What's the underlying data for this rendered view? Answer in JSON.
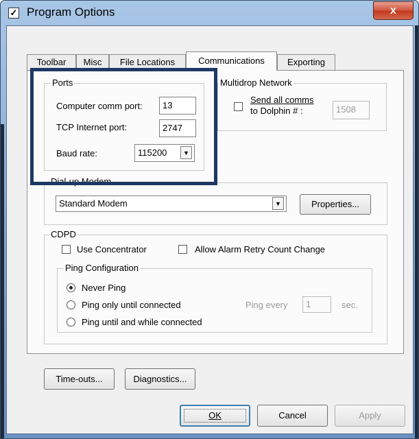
{
  "window": {
    "title": "Program Options",
    "close_glyph": "x"
  },
  "tabs": [
    {
      "label": "Toolbar",
      "active": false
    },
    {
      "label": "Misc",
      "active": false
    },
    {
      "label": "File Locations",
      "active": false
    },
    {
      "label": "Communications",
      "active": true
    },
    {
      "label": "Exporting",
      "active": false
    }
  ],
  "ports": {
    "group_label": "Ports",
    "computer_comm_port_label": "Computer comm port:",
    "computer_comm_port_value": "13",
    "tcp_port_label": "TCP Internet port:",
    "tcp_port_value": "2747",
    "baud_rate_label": "Baud rate:",
    "baud_rate_value": "115200"
  },
  "multidrop": {
    "group_label": "Multidrop Network",
    "send_all_line1": "Send all comms",
    "send_all_line2": "to Dolphin # :",
    "send_all_checked": false,
    "dolphin_number": "1508"
  },
  "dialup": {
    "group_label": "Dial-up Modem",
    "modem_value": "Standard Modem",
    "properties_button": "Properties..."
  },
  "cdpd": {
    "group_label": "CDPD",
    "use_concentrator_label": "Use Concentrator",
    "use_concentrator_checked": false,
    "allow_alarm_label": "Allow Alarm Retry Count Change",
    "allow_alarm_checked": false,
    "ping": {
      "group_label": "Ping Configuration",
      "options": [
        {
          "label": "Never Ping",
          "checked": true
        },
        {
          "label": "Ping only until connected",
          "checked": false
        },
        {
          "label": "Ping until and while connected",
          "checked": false
        }
      ],
      "ping_every_label": "Ping every",
      "ping_every_value": "1",
      "sec_label": "sec."
    }
  },
  "buttons": {
    "timeouts": "Time-outs...",
    "diagnostics": "Diagnostics...",
    "ok": "OK",
    "cancel": "Cancel",
    "apply": "Apply"
  },
  "colors": {
    "highlight_box": "#1f3864",
    "close_button": "#c23a20"
  }
}
